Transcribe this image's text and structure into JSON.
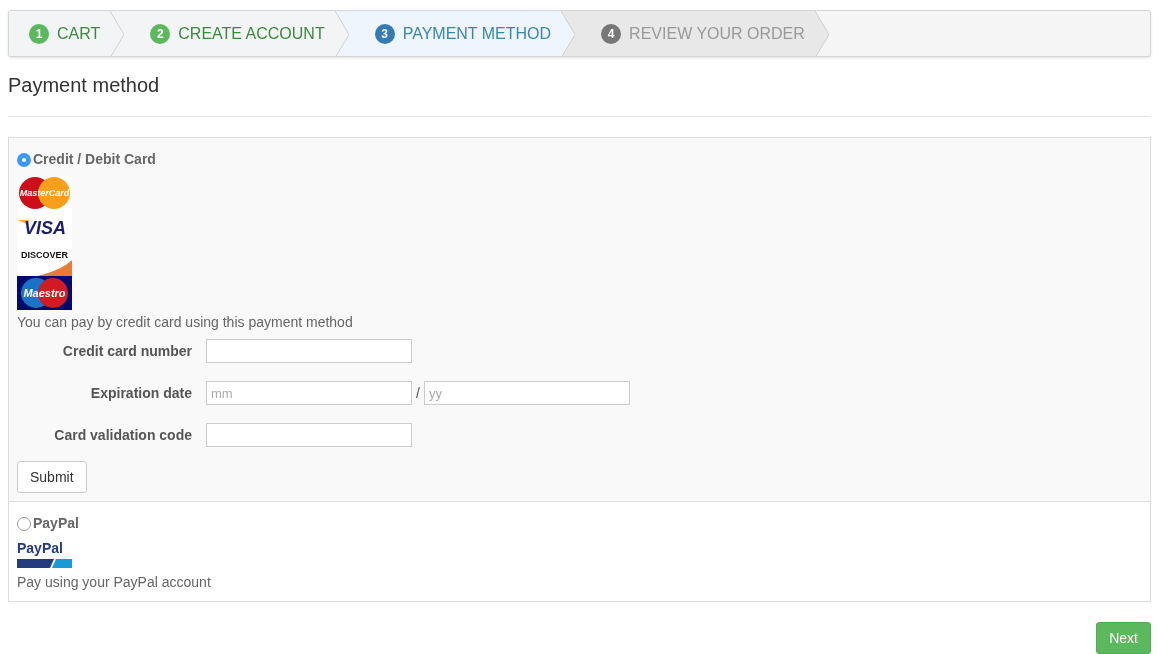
{
  "steps": [
    {
      "number": "1",
      "label": "CART",
      "done": true,
      "selected": false
    },
    {
      "number": "2",
      "label": "CREATE ACCOUNT",
      "done": true,
      "selected": false
    },
    {
      "number": "3",
      "label": "PAYMENT METHOD",
      "done": false,
      "selected": true
    },
    {
      "number": "4",
      "label": "REVIEW YOUR ORDER",
      "done": false,
      "selected": false
    }
  ],
  "heading": "Payment method",
  "methods": [
    {
      "title": "Credit / Debit Card",
      "selected": true,
      "logos": [
        {
          "kind": "mastercard",
          "text": "MasterCard"
        },
        {
          "kind": "visa",
          "text": "VISA"
        },
        {
          "kind": "discover",
          "text": "DISCOVER"
        },
        {
          "kind": "maestro",
          "text": "Maestro"
        }
      ],
      "description": "You can pay by credit card using this payment method",
      "fields": [
        {
          "kind": "text",
          "label": "Credit card number"
        },
        {
          "kind": "pair",
          "label": "Expiration date",
          "placeholders": [
            "mm",
            "yy"
          ],
          "separator": "/"
        },
        {
          "kind": "text",
          "label": "Card validation code"
        }
      ],
      "button": "Submit"
    },
    {
      "title": "PayPal",
      "selected": false,
      "logos": [
        {
          "kind": "paypal",
          "text": "PayPal"
        }
      ],
      "description": "Pay using your PayPal account"
    }
  ],
  "next_button": "Next"
}
